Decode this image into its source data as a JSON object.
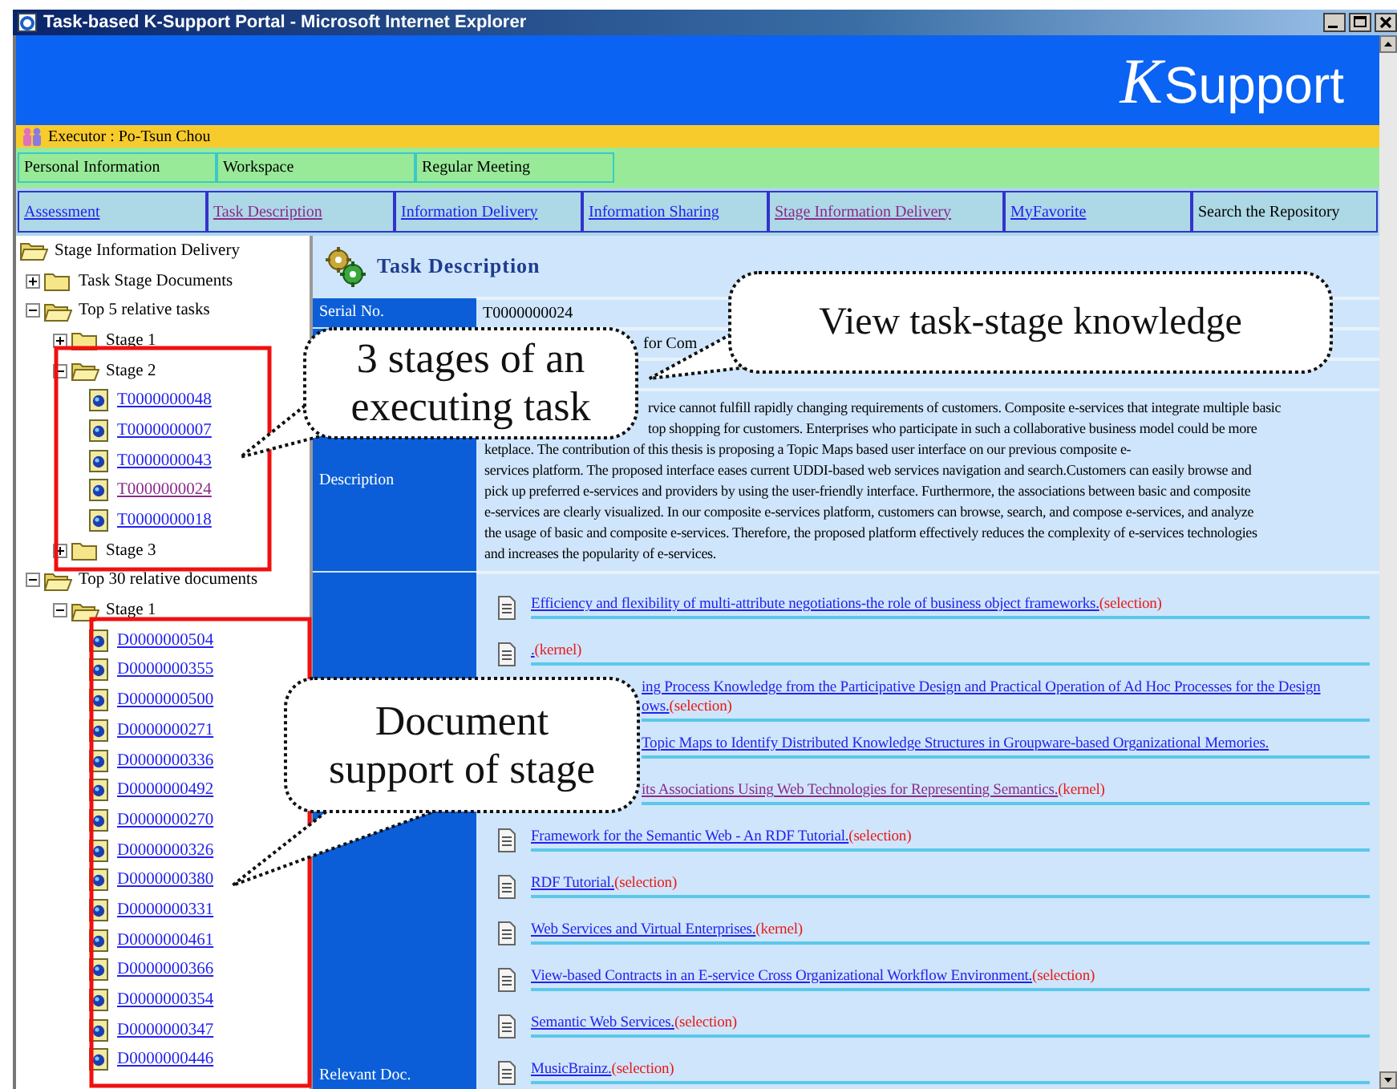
{
  "window": {
    "title": "Task-based K-Support Portal - Microsoft Internet Explorer"
  },
  "logo": {
    "initial": "K",
    "text": "Support"
  },
  "executor": "Executor : Po-Tsun Chou",
  "workspace_tabs": [
    "Personal Information",
    "Workspace",
    "Regular Meeting"
  ],
  "nav": [
    {
      "label": "Assessment",
      "kind": "link",
      "visited": false
    },
    {
      "label": "Task Description",
      "kind": "link",
      "visited": true
    },
    {
      "label": "Information Delivery",
      "kind": "link",
      "visited": false
    },
    {
      "label": "Information Sharing",
      "kind": "link",
      "visited": false
    },
    {
      "label": "Stage Information Delivery",
      "kind": "link",
      "visited": true
    },
    {
      "label": "MyFavorite",
      "kind": "link",
      "visited": false
    },
    {
      "label": "Search the Repository",
      "kind": "text"
    }
  ],
  "tree": {
    "label": "Stage Information Delivery",
    "kind": "folder",
    "expanded": true,
    "children": [
      {
        "label": "Task Stage Documents",
        "kind": "folder",
        "expanded": false
      },
      {
        "label": "Top 5 relative tasks",
        "kind": "folder",
        "expanded": true,
        "children": [
          {
            "label": "Stage 1",
            "kind": "folder",
            "expanded": false
          },
          {
            "label": "Stage 2",
            "kind": "folder",
            "expanded": true,
            "children": [
              {
                "label": "T0000000048",
                "kind": "link",
                "visited": false
              },
              {
                "label": "T0000000007",
                "kind": "link",
                "visited": false
              },
              {
                "label": "T0000000043",
                "kind": "link",
                "visited": false
              },
              {
                "label": "T0000000024",
                "kind": "link",
                "visited": true
              },
              {
                "label": "T0000000018",
                "kind": "link",
                "visited": false
              }
            ]
          },
          {
            "label": "Stage 3",
            "kind": "folder",
            "expanded": false
          }
        ]
      },
      {
        "label": "Top 30 relative documents",
        "kind": "folder",
        "expanded": true,
        "children": [
          {
            "label": "Stage 1",
            "kind": "folder",
            "expanded": true,
            "children": [
              {
                "label": "D0000000504",
                "kind": "link",
                "visited": false
              },
              {
                "label": "D0000000355",
                "kind": "link",
                "visited": false
              },
              {
                "label": "D0000000500",
                "kind": "link",
                "visited": false
              },
              {
                "label": "D0000000271",
                "kind": "link",
                "visited": false
              },
              {
                "label": "D0000000336",
                "kind": "link",
                "visited": false
              },
              {
                "label": "D0000000492",
                "kind": "link",
                "visited": false
              },
              {
                "label": "D0000000270",
                "kind": "link",
                "visited": false
              },
              {
                "label": "D0000000326",
                "kind": "link",
                "visited": false
              },
              {
                "label": "D0000000380",
                "kind": "link",
                "visited": false
              },
              {
                "label": "D0000000331",
                "kind": "link",
                "visited": false
              },
              {
                "label": "D0000000461",
                "kind": "link",
                "visited": false
              },
              {
                "label": "D0000000366",
                "kind": "link",
                "visited": false
              },
              {
                "label": "D0000000354",
                "kind": "link",
                "visited": false
              },
              {
                "label": "D0000000347",
                "kind": "link",
                "visited": false
              },
              {
                "label": "D0000000446",
                "kind": "link",
                "visited": false
              }
            ]
          }
        ]
      }
    ]
  },
  "content": {
    "title": "Task Description",
    "fields": [
      {
        "label": "Serial No.",
        "value": "T0000000024",
        "covered": false
      },
      {
        "value": "for Com",
        "covered": true
      }
    ],
    "description": {
      "label": "Description",
      "lines": [
        {
          "kind": "partial",
          "text": "rvice cannot fulfill rapidly changing requirements of customers. Composite e-services that integrate multiple basic"
        },
        {
          "kind": "partial",
          "text": "top shopping for customers. Enterprises who participate in such a collaborative business model could be more"
        },
        {
          "kind": "full",
          "text": "ketplace. The contribution of this thesis is proposing a Topic Maps based user interface on our previous composite e-"
        },
        {
          "kind": "full",
          "text": "services platform. The proposed interface eases current UDDI-based web services navigation and search.Customers can easily browse and"
        },
        {
          "kind": "full",
          "text": "pick up preferred e-services and providers by using the user-friendly interface. Furthermore, the associations between basic and composite"
        },
        {
          "kind": "full",
          "text": "e-services are clearly visualized. In our composite e-services platform, customers can browse, search, and compose e-services, and analyze"
        },
        {
          "kind": "full",
          "text": "the usage of basic and composite e-services. Therefore, the proposed platform effectively reduces the complexity of e-services technologies"
        },
        {
          "kind": "full",
          "text": "and increases the popularity of e-services."
        }
      ]
    },
    "relevant_docs": {
      "label": "Relevant Doc.",
      "items": [
        {
          "kind": "full",
          "title": "Efficiency and flexibility of multi-attribute negotiations-the role of business object frameworks.",
          "tag": "(selection)",
          "visited": false
        },
        {
          "kind": "full",
          "title": ".",
          "tag": "(kernel)",
          "visited": false
        },
        {
          "kind": "partial",
          "title": "ing Process Knowledge from the Participative Design and Practical Operation of Ad Hoc Processes for the Design",
          "continuation": "ows.",
          "tag": "(selection)",
          "visited": false
        },
        {
          "kind": "partial",
          "title": "Topic Maps to Identify Distributed Knowledge Structures in Groupware-based Organizational Memories.",
          "visited": false
        },
        {
          "kind": "partial",
          "title": "its Associations Using Web Technologies for Representing Semantics.",
          "tag": "(kernel)",
          "visited": true
        },
        {
          "kind": "full",
          "title": "Framework for the Semantic Web - An RDF Tutorial.",
          "tag": "(selection)",
          "visited": false
        },
        {
          "kind": "full",
          "title": "RDF Tutorial.",
          "tag": "(selection)",
          "visited": false
        },
        {
          "kind": "full",
          "title": "Web Services and Virtual Enterprises.",
          "tag": "(kernel)",
          "visited": false
        },
        {
          "kind": "full",
          "title": "View-based Contracts in an E-service Cross Organizational Workflow Environment.",
          "tag": "(selection)",
          "visited": false
        },
        {
          "kind": "full",
          "title": "Semantic Web Services.",
          "tag": "(selection)",
          "visited": false
        },
        {
          "kind": "full",
          "title": "MusicBrainz.",
          "tag": "(selection)",
          "visited": false
        }
      ]
    }
  },
  "callouts": [
    {
      "lines": [
        "View task-stage knowledge"
      ]
    },
    {
      "lines": [
        "3 stages of an",
        "executing task"
      ]
    },
    {
      "lines": [
        "Document",
        "support of stage"
      ]
    }
  ]
}
